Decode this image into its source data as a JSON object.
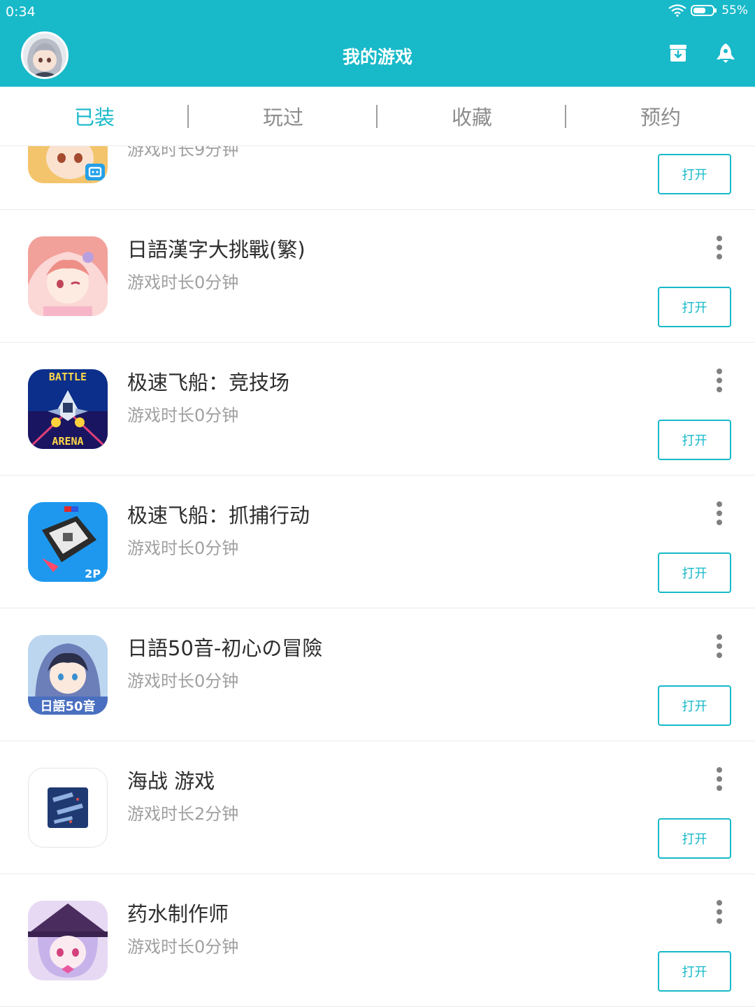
{
  "status_bar": {
    "time": "0:34",
    "battery": "55%"
  },
  "header": {
    "title": "我的游戏"
  },
  "tabs": [
    {
      "label": "已装",
      "active": true
    },
    {
      "label": "玩过",
      "active": false
    },
    {
      "label": "收藏",
      "active": false
    },
    {
      "label": "预约",
      "active": false
    }
  ],
  "games": [
    {
      "name": "",
      "playtime": "游戏时长9分钟",
      "open_label": "打开"
    },
    {
      "name": "日語漢字大挑戰(繁)",
      "playtime": "游戏时长0分钟",
      "open_label": "打开"
    },
    {
      "name": "极速飞船：竞技场",
      "playtime": "游戏时长0分钟",
      "open_label": "打开"
    },
    {
      "name": "极速飞船：抓捕行动",
      "playtime": "游戏时长0分钟",
      "open_label": "打开"
    },
    {
      "name": "日語50音-初心の冒險",
      "playtime": "游戏时长0分钟",
      "open_label": "打开"
    },
    {
      "name": "海战 游戏",
      "playtime": "游戏时长2分钟",
      "open_label": "打开"
    },
    {
      "name": "药水制作师",
      "playtime": "游戏时长0分钟",
      "open_label": "打开"
    }
  ],
  "icon_texts": {
    "battle": "BATTLE",
    "arena": "ARENA",
    "jp50": "日語50音",
    "tag_2p": "2P"
  },
  "colors": {
    "accent": "#18b9c9",
    "text_primary": "#2e2e2e",
    "text_secondary": "#a0a0a0"
  },
  "icons": {
    "download": "download-box-icon",
    "rocket": "rocket-icon",
    "more": "more-vertical-icon"
  }
}
